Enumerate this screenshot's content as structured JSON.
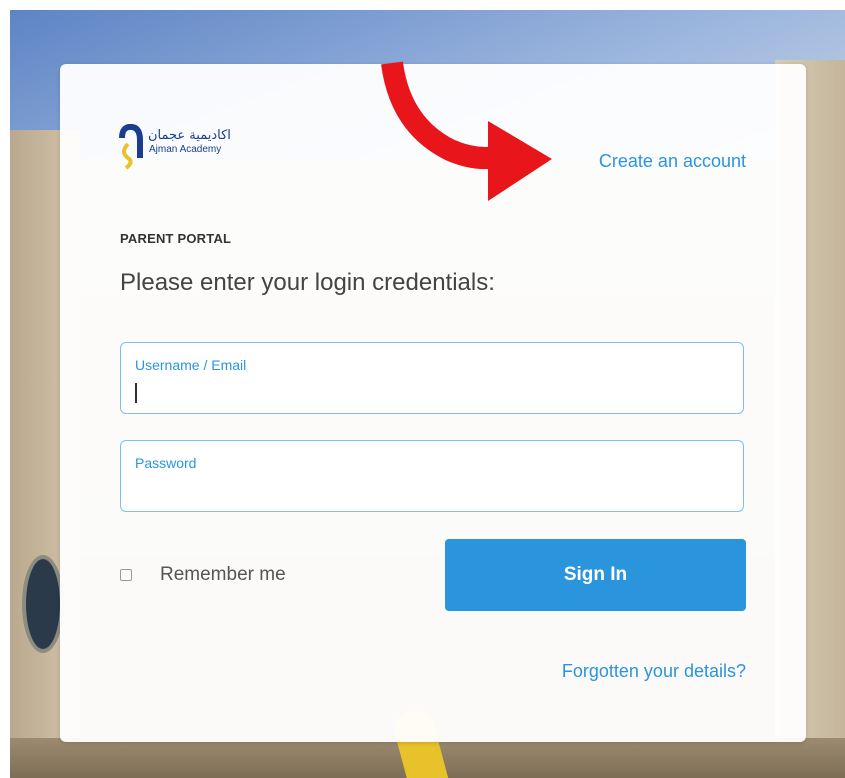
{
  "logo": {
    "arabic_text": "اكاديمية عجمان",
    "english_text": "Ajman Academy"
  },
  "header": {
    "create_account_label": "Create an account"
  },
  "form": {
    "portal_label": "PARENT PORTAL",
    "prompt": "Please enter your login credentials:",
    "username": {
      "label": "Username / Email",
      "value": ""
    },
    "password": {
      "label": "Password",
      "value": ""
    },
    "remember_label": "Remember me",
    "remember_checked": false,
    "signin_label": "Sign In",
    "forgot_label": "Forgotten your details?"
  },
  "colors": {
    "accent": "#2a95dd",
    "annotation_arrow": "#e8151b"
  }
}
